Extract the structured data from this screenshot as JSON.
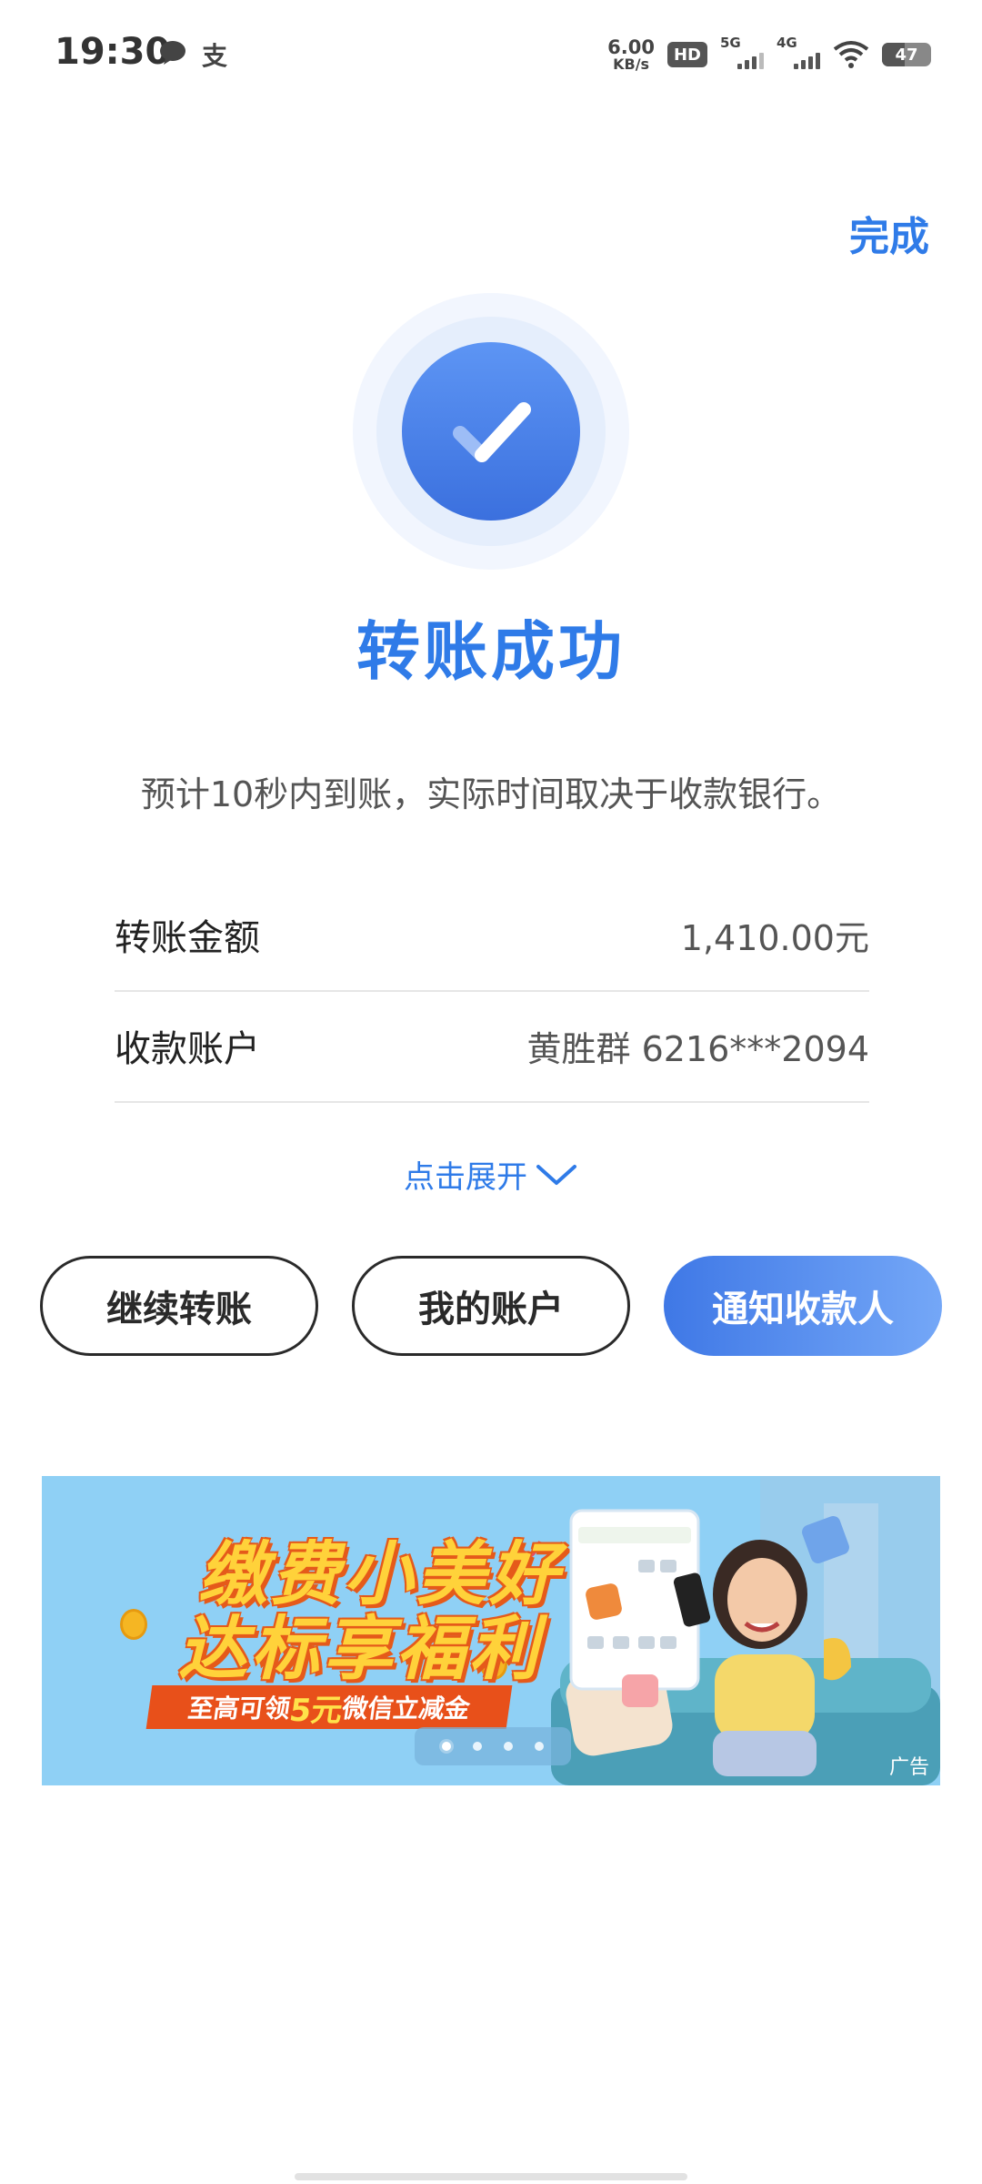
{
  "status_bar": {
    "time": "19:30",
    "net_speed": "6.00",
    "net_unit": "KB/s",
    "hd": "HD",
    "sig1": "5G",
    "sig2": "4G",
    "battery": "47",
    "battery_level": 0.47
  },
  "header": {
    "done_label": "完成"
  },
  "result": {
    "title": "转账成功",
    "subtitle": "预计10秒内到账，实际时间取决于收款银行。"
  },
  "details": [
    {
      "label": "转账金额",
      "value": "1,410.00元"
    },
    {
      "label": "收款账户",
      "value": "黄胜群 6216***2094"
    }
  ],
  "expand_label": "点击展开",
  "actions": {
    "continue": "继续转账",
    "my_account": "我的账户",
    "notify": "通知收款人"
  },
  "banner": {
    "line1": "缴费小美好",
    "line2": "达标享福利",
    "ribbon_pre": "至高可领",
    "ribbon_num": "5元",
    "ribbon_post": "微信立减金",
    "ad_label": "广告",
    "page_count": 4,
    "active_page": 1
  },
  "colors": {
    "accent": "#2f7be8",
    "button_gradient_start": "#3f78e6",
    "button_gradient_end": "#74a7f7",
    "banner_bg": "#8fd0f5"
  }
}
